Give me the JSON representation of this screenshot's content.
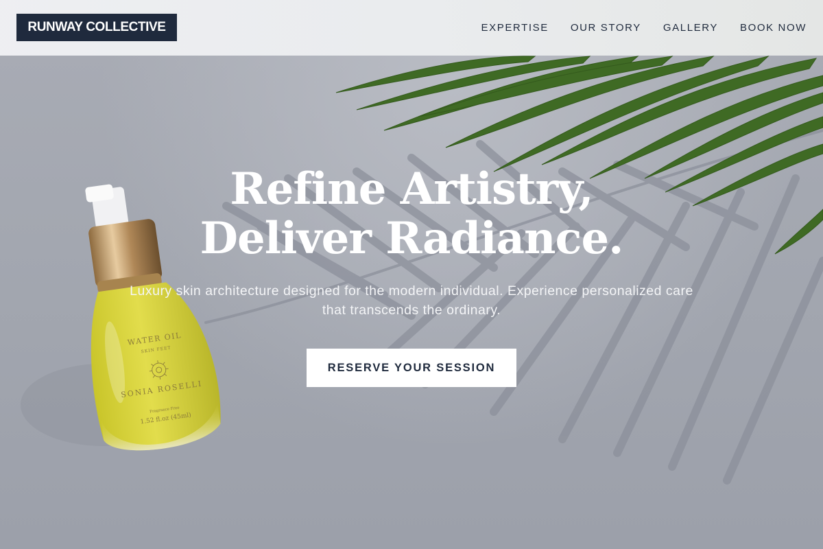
{
  "header": {
    "logo_text": "RUNWAY COLLECTIVE",
    "nav": [
      {
        "label": "EXPERTISE"
      },
      {
        "label": "OUR STORY"
      },
      {
        "label": "GALLERY"
      },
      {
        "label": "BOOK NOW"
      }
    ]
  },
  "hero": {
    "title_line_1": "Refine Artistry,",
    "title_line_2": "Deliver Radiance.",
    "subtitle": "Luxury skin architecture designed for the modern individual. Experience personalized care that transcends the ordinary.",
    "cta_label": "RESERVE YOUR SESSION"
  },
  "product": {
    "label_line_1": "WATER OIL",
    "label_line_2": "SKIN FEET",
    "label_brand": "SONIA ROSELLI",
    "label_fine_1": "Fragrance Free",
    "label_fine_2": "1.52 fl.oz (45ml)"
  },
  "colors": {
    "brand_navy": "#1f2a3d",
    "button_bg": "#ffffff",
    "hero_text": "#ffffff",
    "leaf_green": "#3f6a24",
    "oil_yellow": "#d9d43a"
  }
}
